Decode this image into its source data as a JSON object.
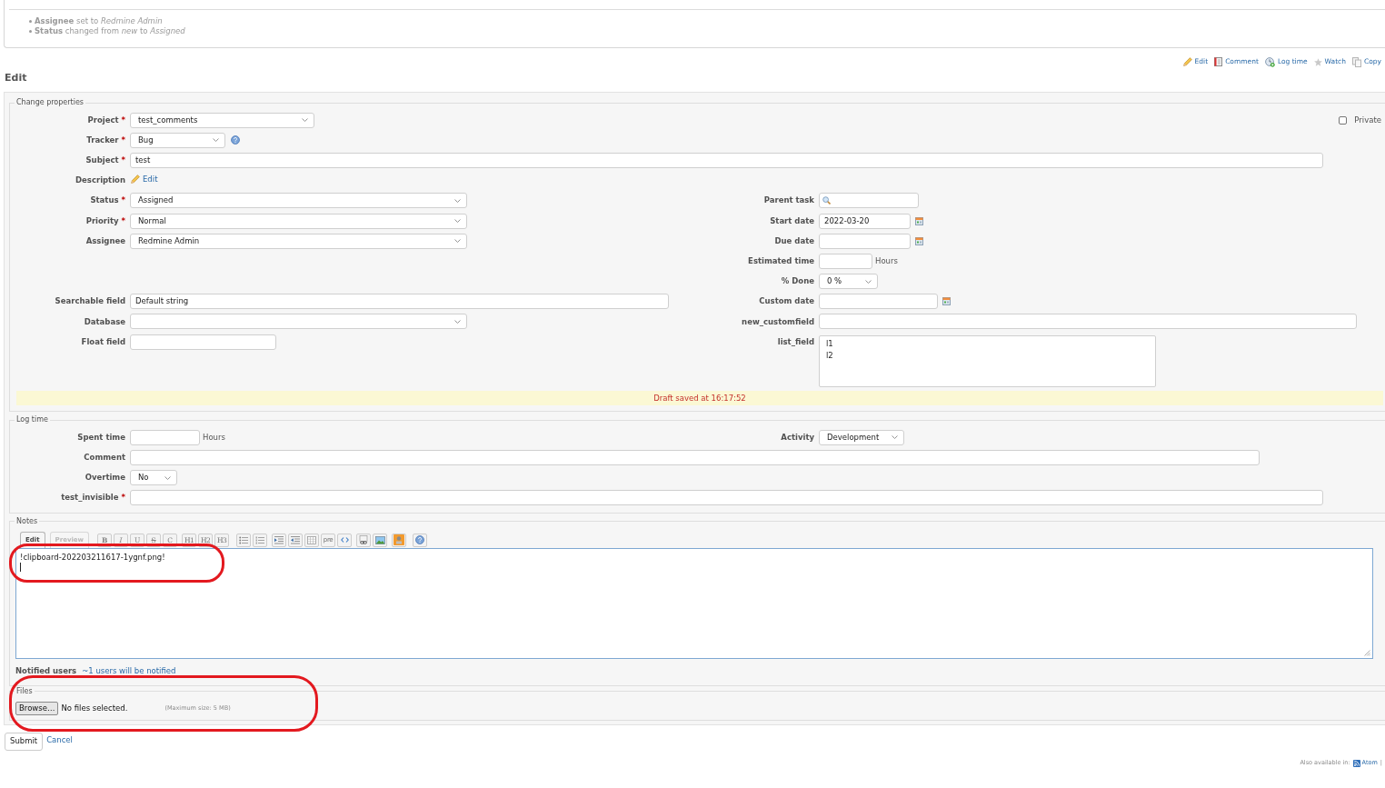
{
  "journal": {
    "details": [
      "**Assignee** set to *Redmine Admin*",
      "**Status** changed from *new* to *Assigned*"
    ]
  },
  "contextual_links": [
    {
      "kind": "edit",
      "label": "Edit"
    },
    {
      "kind": "comment",
      "label": "Comment"
    },
    {
      "kind": "log_time",
      "label": "Log time"
    },
    {
      "kind": "watch",
      "label": "Watch"
    },
    {
      "kind": "copy",
      "label": "Copy"
    }
  ],
  "heading": "Edit",
  "change_properties": {
    "legend": "Change properties",
    "private": {
      "label": "Private",
      "checked": false
    },
    "main_fields": [
      {
        "label": "Project",
        "required_mark": "*",
        "kind": "select",
        "value": "test_comments"
      },
      {
        "label": "Tracker",
        "required_mark": "*",
        "kind": "select",
        "value": "Bug",
        "help": true
      },
      {
        "label": "Subject",
        "required_mark": "*",
        "kind": "text",
        "value": "test"
      },
      {
        "label": "Description",
        "kind": "edit_link",
        "value": "Edit"
      }
    ],
    "left_fields": [
      {
        "label": "Status",
        "required_mark": "*",
        "kind": "select",
        "value": "Assigned"
      },
      {
        "label": "Priority",
        "required_mark": "*",
        "kind": "select",
        "value": "Normal"
      },
      {
        "label": "Assignee",
        "kind": "select",
        "value": "Redmine Admin"
      }
    ],
    "right_fields": [
      {
        "label": "Parent task",
        "kind": "search"
      },
      {
        "label": "Start date",
        "kind": "date",
        "value": "2022-03-20"
      },
      {
        "label": "Due date",
        "kind": "date"
      },
      {
        "label": "Estimated time",
        "kind": "hours",
        "unit": "Hours"
      },
      {
        "label": "% Done",
        "kind": "select",
        "value": "0 %"
      }
    ],
    "custom_left": [
      {
        "label": "Searchable field",
        "kind": "text",
        "value": "Default string"
      },
      {
        "label": "Database",
        "kind": "select"
      },
      {
        "label": "Float field",
        "kind": "text"
      }
    ],
    "custom_right": [
      {
        "label": "Custom date",
        "kind": "date"
      },
      {
        "label": "new_customfield",
        "kind": "text"
      },
      {
        "label": "list_field",
        "kind": "listbox",
        "options": [
          "l1",
          "l2"
        ]
      }
    ],
    "draft_notice": "Draft saved at 16:17:52"
  },
  "log_time": {
    "legend": "Log time",
    "left_fields": [
      {
        "label": "Spent time",
        "kind": "hours",
        "unit": "Hours"
      }
    ],
    "right_fields": [
      {
        "label": "Activity",
        "kind": "select",
        "value": "Development"
      }
    ],
    "fields": [
      {
        "label": "Comment",
        "kind": "text"
      },
      {
        "label": "Overtime",
        "kind": "select",
        "value": "No"
      },
      {
        "label": "test_invisible",
        "required_mark": "*",
        "kind": "text"
      }
    ]
  },
  "notes": {
    "legend": "Notes",
    "highlighted": true,
    "tabs": [
      {
        "label": "Edit",
        "selected": true
      },
      {
        "label": "Preview",
        "selected": false
      }
    ],
    "format_buttons": [
      "B",
      "I",
      "U",
      "S",
      "C"
    ],
    "heading_buttons": [
      "H1",
      "H2",
      "H3"
    ],
    "pre_button": "pre",
    "text": "!clipboard-202203211617-1ygnf.png!",
    "notified_label": "Notified users",
    "notified_link": "~1 users will be notified"
  },
  "files": {
    "legend": "Files",
    "highlighted": true,
    "button": "Browse…",
    "status": "No files selected.",
    "limit": "(Maximum size: 5 MB)"
  },
  "actions": [
    {
      "kind": "button",
      "label": "Submit"
    },
    {
      "kind": "link",
      "label": "Cancel"
    }
  ],
  "footer": {
    "label": "Also available in:",
    "links": [
      {
        "kind": "atom",
        "label": "Atom"
      }
    ],
    "separator": "|"
  }
}
